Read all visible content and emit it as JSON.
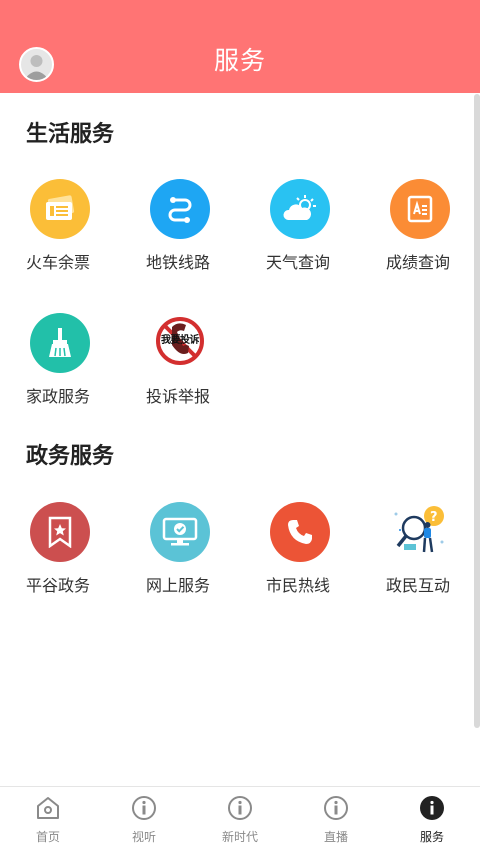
{
  "header": {
    "title": "服务"
  },
  "sections": [
    {
      "title": "生活服务",
      "items": [
        {
          "label": "火车余票",
          "icon": "train-ticket-icon",
          "color": "#fbbe38"
        },
        {
          "label": "地铁线路",
          "icon": "subway-route-icon",
          "color": "#1ea6f3"
        },
        {
          "label": "天气查询",
          "icon": "weather-icon",
          "color": "#29c2f2"
        },
        {
          "label": "成绩查询",
          "icon": "score-query-icon",
          "color": "#fb8c35"
        },
        {
          "label": "家政服务",
          "icon": "broom-icon",
          "color": "#22c0a9"
        },
        {
          "label": "投诉举报",
          "icon": "complaint-phone-icon",
          "badge_text": "我要投诉"
        }
      ]
    },
    {
      "title": "政务服务",
      "items": [
        {
          "label": "平谷政务",
          "icon": "government-bookmark-icon",
          "color": "#cc4f4f"
        },
        {
          "label": "网上服务",
          "icon": "online-service-monitor-icon",
          "color": "#5bc3d6"
        },
        {
          "label": "市民热线",
          "icon": "phone-hotline-icon",
          "color": "#ec5436"
        },
        {
          "label": "政民互动",
          "icon": "interaction-illustration-icon"
        }
      ]
    }
  ],
  "tabbar": {
    "items": [
      {
        "label": "首页",
        "icon": "home-icon",
        "active": false
      },
      {
        "label": "视听",
        "icon": "info-icon",
        "active": false
      },
      {
        "label": "新时代",
        "icon": "info-icon",
        "active": false
      },
      {
        "label": "直播",
        "icon": "info-icon",
        "active": false
      },
      {
        "label": "服务",
        "icon": "info-filled-icon",
        "active": true
      }
    ]
  },
  "colors": {
    "header_bg": "#ff7474",
    "tab_inactive": "#8a8a8a",
    "tab_active": "#222222"
  }
}
